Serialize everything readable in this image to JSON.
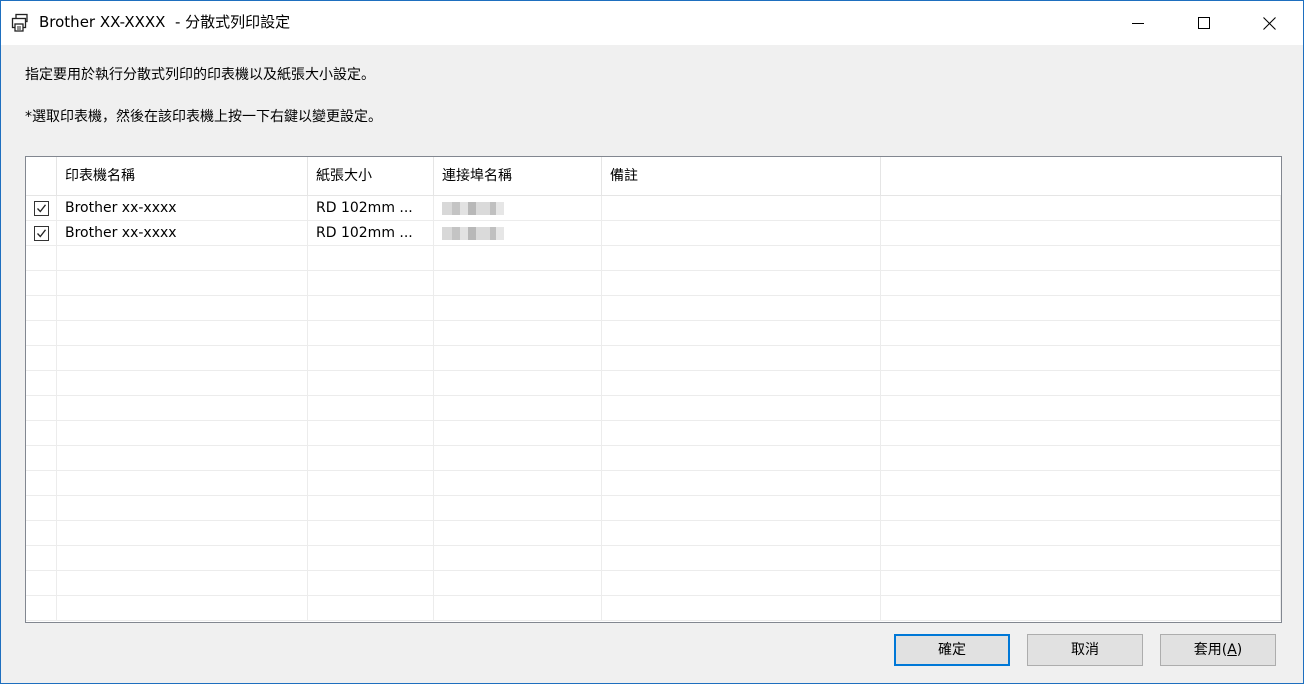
{
  "window": {
    "title": "Brother XX-XXXX  - 分散式列印設定",
    "icon": "printer-icon",
    "controls": [
      "minimize-icon",
      "maximize-icon",
      "close-icon"
    ]
  },
  "instructions": {
    "line1": "指定要用於執行分散式列印的印表機以及紙張大小設定。",
    "line2": "*選取印表機，然後在該印表機上按一下右鍵以變更設定。"
  },
  "table": {
    "headers": [
      "",
      "印表機名稱",
      "紙張大小",
      "連接埠名稱",
      "備註",
      ""
    ],
    "rows": [
      {
        "checked": true,
        "printer": "Brother xx-xxxx",
        "paper": "RD 102mm ...",
        "port": "",
        "note": ""
      },
      {
        "checked": true,
        "printer": "Brother xx-xxxx",
        "paper": "RD 102mm ...",
        "port": "",
        "note": ""
      }
    ]
  },
  "buttons": {
    "ok": "確定",
    "cancel": "取消",
    "apply_prefix": "套用(",
    "apply_mnemonic": "A",
    "apply_suffix": ")"
  },
  "colors": {
    "accent": "#0078d7",
    "window_border": "#1e6fbf",
    "background": "#f0f0f0"
  }
}
